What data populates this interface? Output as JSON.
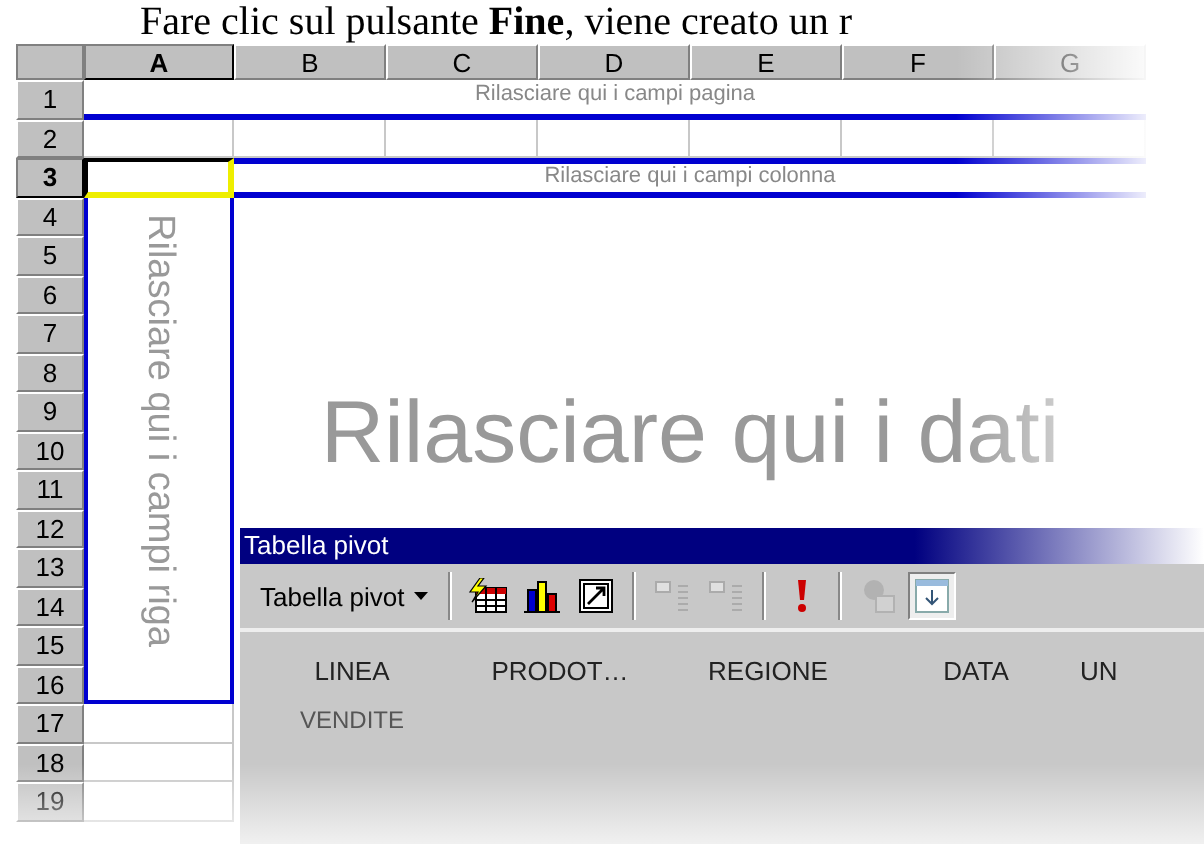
{
  "intro_text": "Fare clic sul pulsante **Fine**, viene creato un r",
  "sheet": {
    "columns": [
      {
        "label": "A",
        "selected": true
      },
      {
        "label": "B",
        "selected": false
      },
      {
        "label": "C",
        "selected": false
      },
      {
        "label": "D",
        "selected": false
      },
      {
        "label": "E",
        "selected": false
      },
      {
        "label": "F",
        "selected": false
      },
      {
        "label": "G",
        "selected": false
      }
    ],
    "rows": [
      {
        "label": "1",
        "selected": false
      },
      {
        "label": "2",
        "selected": false
      },
      {
        "label": "3",
        "selected": true
      },
      {
        "label": "4",
        "selected": false
      },
      {
        "label": "5",
        "selected": false
      },
      {
        "label": "6",
        "selected": false
      },
      {
        "label": "7",
        "selected": false
      },
      {
        "label": "8",
        "selected": false
      },
      {
        "label": "9",
        "selected": false
      },
      {
        "label": "10",
        "selected": false
      },
      {
        "label": "11",
        "selected": false
      },
      {
        "label": "12",
        "selected": false
      },
      {
        "label": "13",
        "selected": false
      },
      {
        "label": "14",
        "selected": false
      },
      {
        "label": "15",
        "selected": false
      },
      {
        "label": "16",
        "selected": false
      },
      {
        "label": "17",
        "selected": false
      },
      {
        "label": "18",
        "selected": false
      },
      {
        "label": "19",
        "selected": false
      }
    ],
    "page_zone": "Rilasciare qui i campi pagina",
    "column_zone": "Rilasciare qui i campi colonna",
    "row_zone": "Rilasciare qui i campi riga",
    "data_zone": "Rilasciare qui i dati"
  },
  "pivot_toolbar": {
    "title": "Tabella pivot",
    "menu": "Tabella pivot",
    "tools": [
      {
        "kind": "wizard",
        "disabled": false,
        "selected": false,
        "separator_before": true
      },
      {
        "kind": "chart",
        "disabled": false,
        "selected": false,
        "separator_before": false
      },
      {
        "kind": "frame",
        "disabled": false,
        "selected": false,
        "separator_before": false
      },
      {
        "kind": "hide",
        "disabled": true,
        "selected": false,
        "separator_before": true
      },
      {
        "kind": "show",
        "disabled": true,
        "selected": false,
        "separator_before": false
      },
      {
        "kind": "refresh",
        "disabled": false,
        "selected": false,
        "separator_before": true
      },
      {
        "kind": "settings",
        "disabled": true,
        "selected": false,
        "separator_before": true
      },
      {
        "kind": "fields",
        "disabled": false,
        "selected": true,
        "separator_before": false
      }
    ],
    "fields": [
      "LINEA",
      "PRODOT…",
      "REGIONE",
      "DATA",
      "UN",
      "VENDITE"
    ]
  }
}
